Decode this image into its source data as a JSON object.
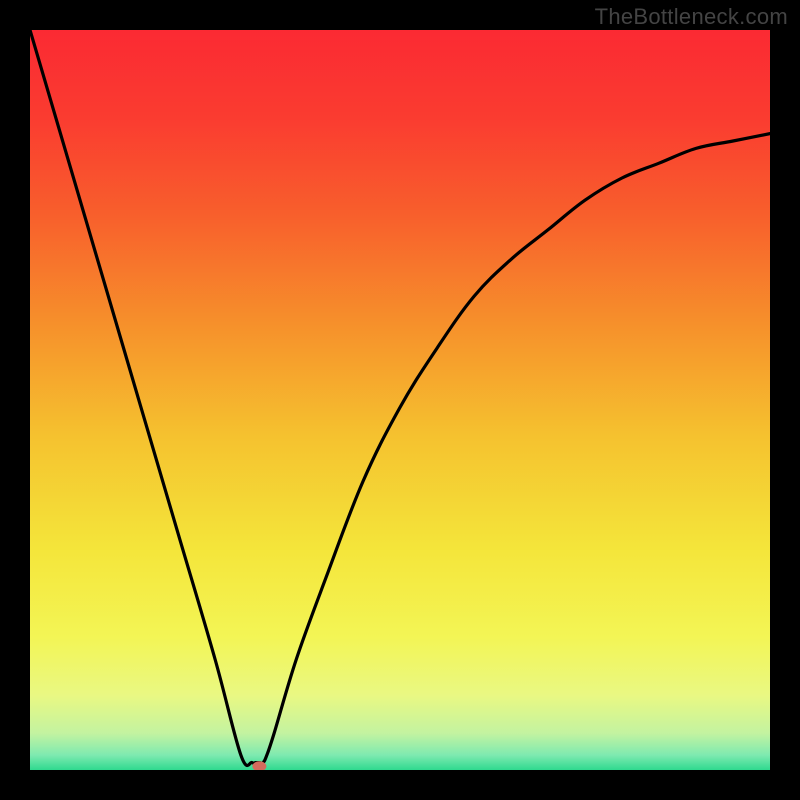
{
  "watermark": "TheBottleneck.com",
  "chart_data": {
    "type": "line",
    "title": "",
    "xlabel": "",
    "ylabel": "",
    "xlim": [
      0,
      1
    ],
    "ylim": [
      0,
      1
    ],
    "grid": false,
    "legend": false,
    "series": [
      {
        "name": "curve",
        "x": [
          0.0,
          0.05,
          0.1,
          0.15,
          0.2,
          0.25,
          0.285,
          0.3,
          0.305,
          0.31,
          0.315,
          0.32,
          0.33,
          0.36,
          0.4,
          0.45,
          0.5,
          0.55,
          0.6,
          0.65,
          0.7,
          0.75,
          0.8,
          0.85,
          0.9,
          0.95,
          1.0
        ],
        "y": [
          1.0,
          0.83,
          0.66,
          0.49,
          0.32,
          0.15,
          0.02,
          0.01,
          0.01,
          0.01,
          0.01,
          0.02,
          0.05,
          0.15,
          0.26,
          0.39,
          0.49,
          0.57,
          0.64,
          0.69,
          0.73,
          0.77,
          0.8,
          0.82,
          0.84,
          0.85,
          0.86
        ]
      }
    ],
    "marker": {
      "x": 0.31,
      "y": 0.005,
      "color": "#d26a5c"
    },
    "background_gradient": {
      "stops": [
        {
          "offset": 0.0,
          "color": "#fb2a33"
        },
        {
          "offset": 0.12,
          "color": "#fa3c30"
        },
        {
          "offset": 0.25,
          "color": "#f85f2c"
        },
        {
          "offset": 0.4,
          "color": "#f6912b"
        },
        {
          "offset": 0.55,
          "color": "#f5c22f"
        },
        {
          "offset": 0.7,
          "color": "#f4e53a"
        },
        {
          "offset": 0.82,
          "color": "#f3f555"
        },
        {
          "offset": 0.9,
          "color": "#e9f883"
        },
        {
          "offset": 0.95,
          "color": "#c4f3a0"
        },
        {
          "offset": 0.98,
          "color": "#7eeab0"
        },
        {
          "offset": 1.0,
          "color": "#2fd98f"
        }
      ]
    }
  }
}
